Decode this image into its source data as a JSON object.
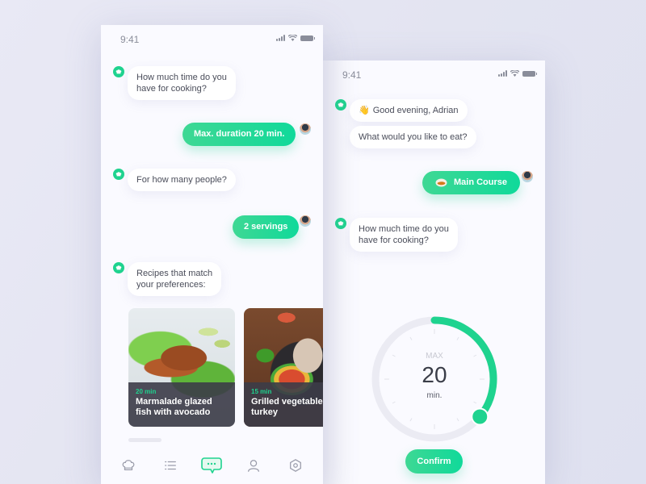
{
  "colors": {
    "accent": "#1fd38f",
    "accent_gradient_start": "#3ed894",
    "accent_gradient_end": "#10d99a",
    "background": "#e5e6f2",
    "screen": "#fafaff",
    "text_primary": "#4a4d5a",
    "card_overlay": "#3c3c48"
  },
  "left_screen": {
    "status_bar": {
      "time": "9:41",
      "icons": [
        "signal-icon",
        "wifi-icon",
        "battery-icon"
      ]
    },
    "messages": [
      {
        "from": "bot",
        "lines": [
          "How much time do you",
          "have for cooking?"
        ]
      },
      {
        "from": "user",
        "text": "Max. duration 20 min."
      },
      {
        "from": "bot",
        "lines": [
          "For how many people?"
        ]
      },
      {
        "from": "user",
        "text": "2 servings"
      },
      {
        "from": "bot",
        "lines": [
          "Recipes that match",
          "your preferences:"
        ]
      }
    ],
    "recipes": [
      {
        "time": "20 min",
        "title_lines": [
          "Marmalade glazed",
          "fish with avocado"
        ],
        "image": "salmon-dish"
      },
      {
        "time": "15 min",
        "title_lines": [
          "Grilled vegetable",
          "turkey"
        ],
        "image": "fajita-dish"
      }
    ],
    "tab_bar": {
      "items": [
        {
          "name": "chef-hat-icon",
          "active": false
        },
        {
          "name": "list-icon",
          "active": false
        },
        {
          "name": "chat-icon",
          "active": true
        },
        {
          "name": "profile-icon",
          "active": false
        },
        {
          "name": "settings-icon",
          "active": false
        }
      ]
    }
  },
  "right_screen": {
    "status_bar": {
      "time": "9:41",
      "icons": [
        "signal-icon",
        "wifi-icon",
        "battery-icon"
      ]
    },
    "messages": [
      {
        "from": "bot",
        "text": "Good evening, Adrian",
        "emoji": "👋"
      },
      {
        "from": "bot",
        "text": "What would you like to eat?"
      },
      {
        "from": "user",
        "text": "Main Course",
        "icon": "dish-icon"
      },
      {
        "from": "bot",
        "lines": [
          "How much time do you",
          "have for cooking?"
        ]
      }
    ],
    "timer": {
      "label_top": "MAX",
      "value": "20",
      "unit": "min.",
      "fraction": 0.36
    },
    "confirm_label": "Confirm"
  }
}
